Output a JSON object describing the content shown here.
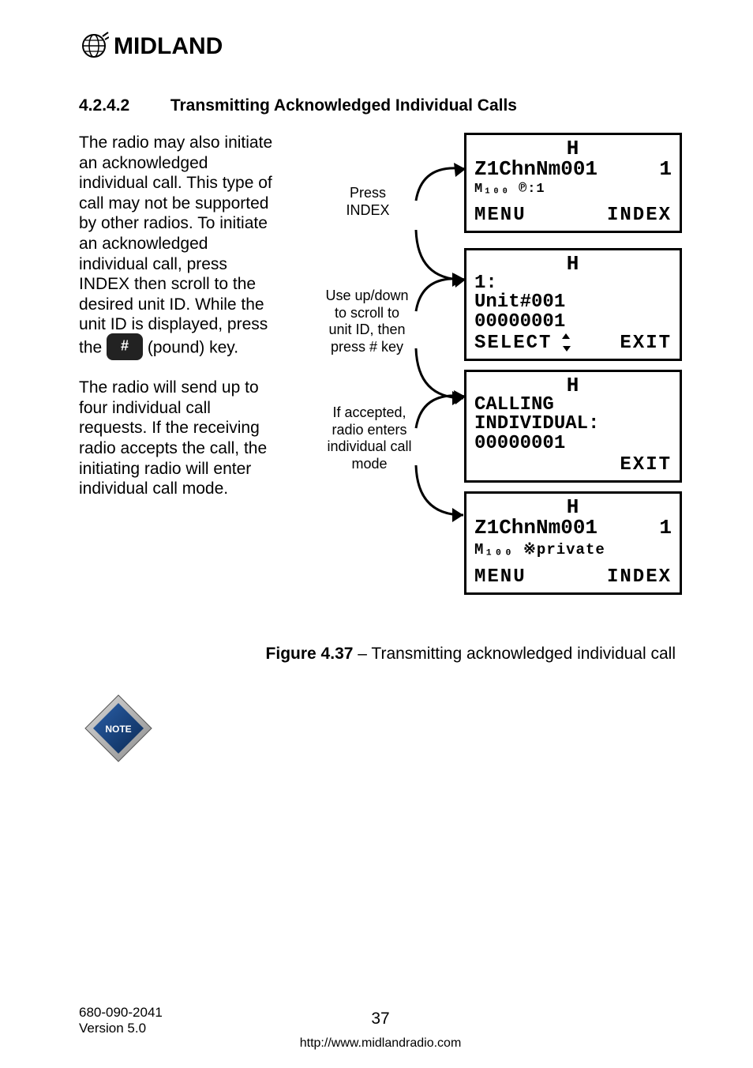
{
  "logo": {
    "brand_text": "MIDLAND"
  },
  "heading": {
    "number": "4.2.4.2",
    "title": "Transmitting Acknowledged Individual Calls"
  },
  "body": {
    "p1": "The radio may also initiate an acknowledged individual call. This type of call may not be supported by other radios. To initiate an acknowledged individual call, press INDEX then scroll to the desired unit ID. While the unit ID is displayed, press",
    "p1_tail_a": "the ",
    "p1_tail_b": " (pound) key.",
    "p2": "The radio will send up to four individual call requests. If the receiving radio accepts the call, the initiating radio will enter individual call mode."
  },
  "steps": {
    "s1a": "Press",
    "s1b": "INDEX",
    "s2a": "Use up/down",
    "s2b": "to scroll to",
    "s2c": "unit ID, then",
    "s2d": "press # key",
    "s3a": "If accepted,",
    "s3b": "radio enters",
    "s3c": "individual call",
    "s3d": "mode"
  },
  "lcd1": {
    "icon": "H",
    "title": "Z1ChnNm001",
    "title_right": "1",
    "status": "M₁₀₀  ℗:1",
    "soft_left": "MENU",
    "soft_right": "INDEX"
  },
  "lcd2": {
    "icon": "H",
    "row1": "1:",
    "row2": "Unit#001",
    "row3": "00000001",
    "soft_left": "SELECT",
    "soft_right": "EXIT"
  },
  "lcd3": {
    "icon": "H",
    "row1": "CALLING",
    "row2": "INDIVIDUAL:",
    "row3": "00000001",
    "soft_right": "EXIT"
  },
  "lcd4": {
    "icon": "H",
    "title": "Z1ChnNm001",
    "title_right": "1",
    "status": "M₁₀₀  ※private",
    "soft_left": "MENU",
    "soft_right": "INDEX"
  },
  "figure": {
    "label": "Figure 4.37",
    "caption": " – Transmitting acknowledged individual call"
  },
  "footer": {
    "doc": "680-090-2041",
    "ver": "Version 5.0",
    "page": "37",
    "url": "http://www.midlandradio.com"
  }
}
